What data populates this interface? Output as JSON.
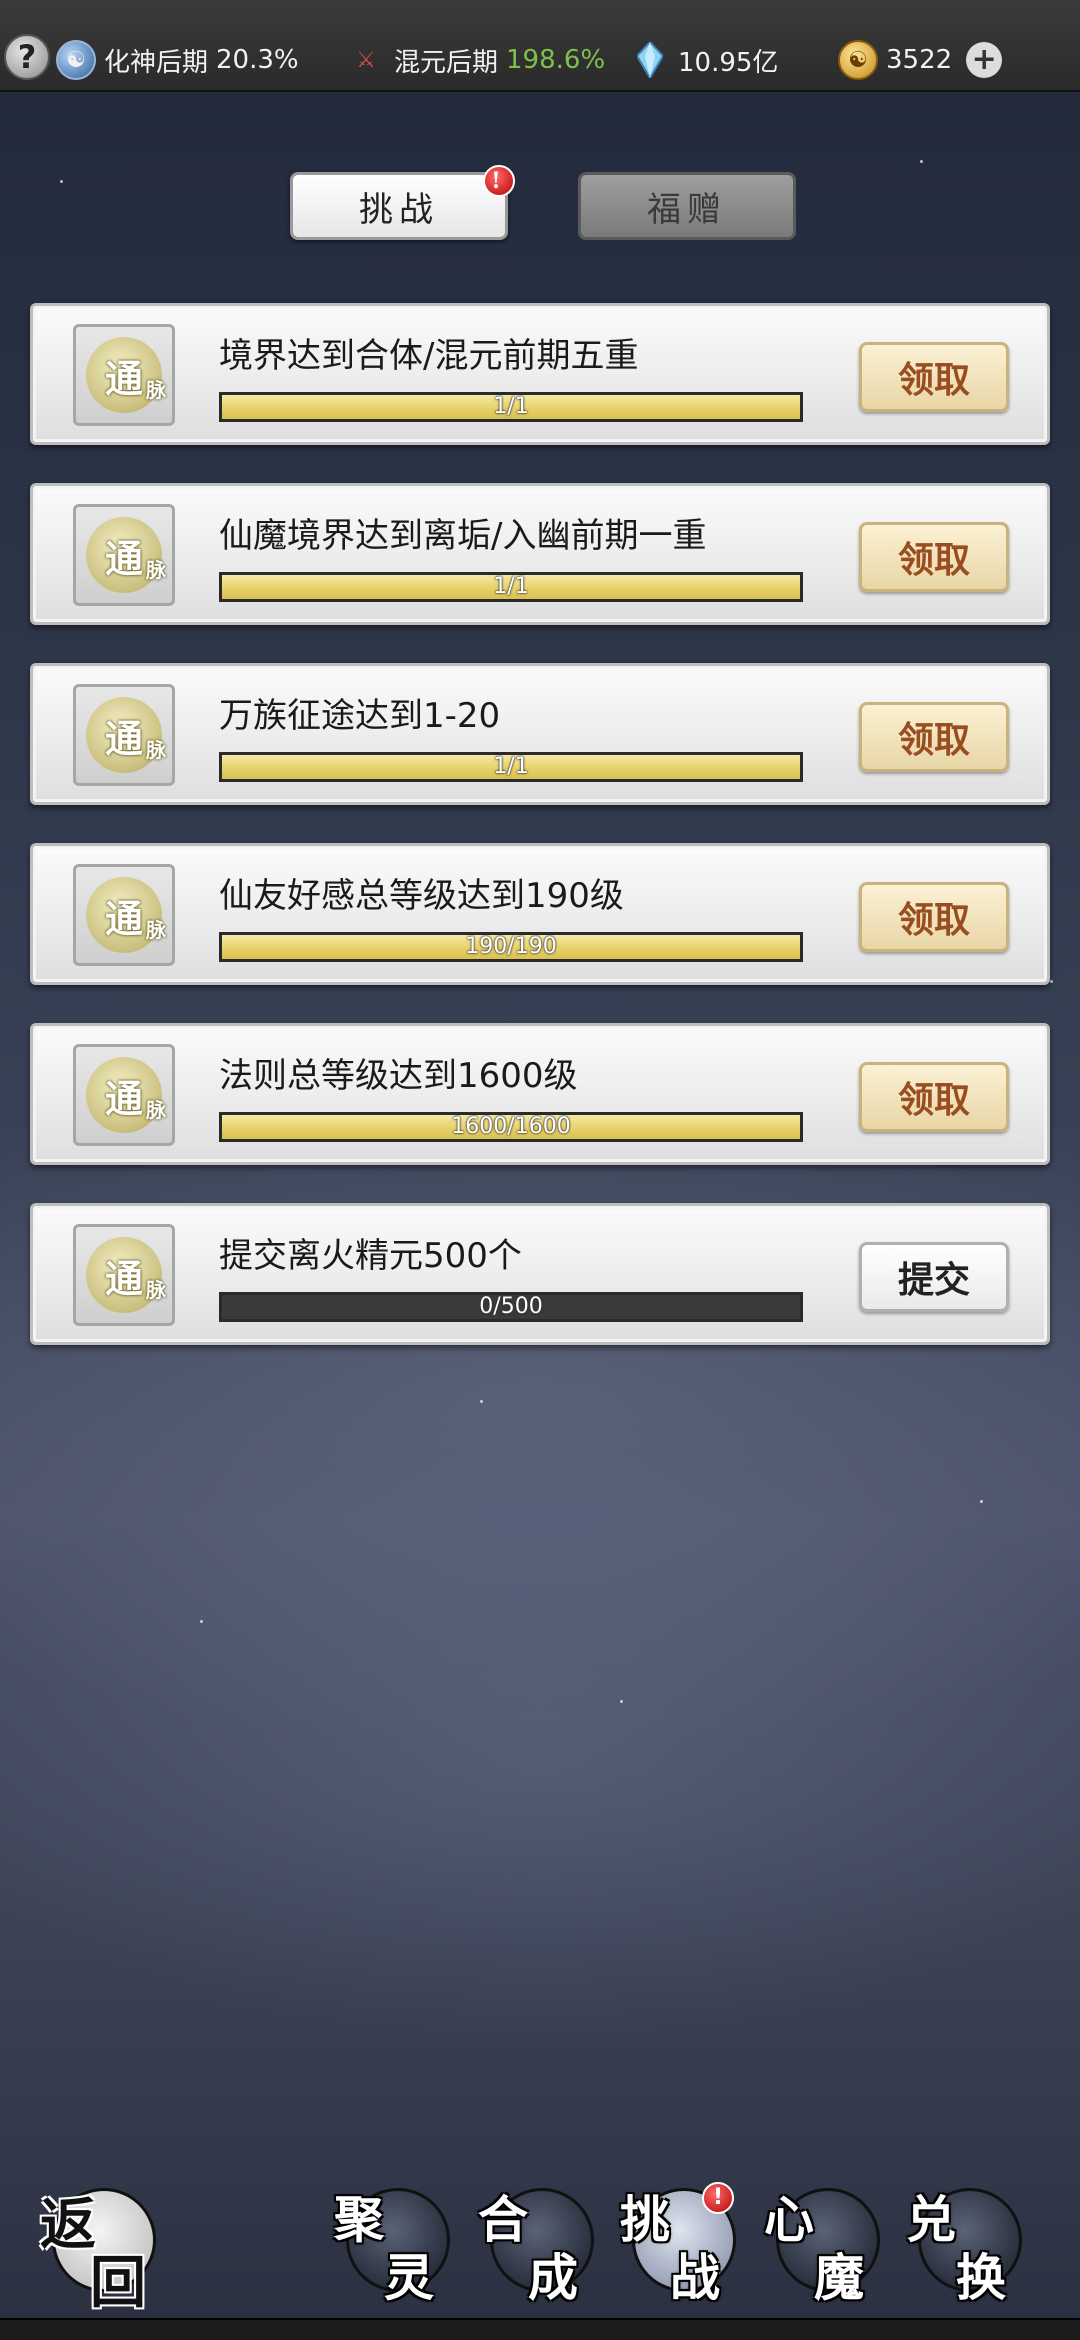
{
  "topbar": {
    "help_glyph": "?",
    "stats": [
      {
        "icon": "taiji-icon",
        "label": "化神后期",
        "value": "20.3%"
      },
      {
        "icon": "sword-icon",
        "label": "混元后期",
        "value": "198.6%"
      },
      {
        "icon": "crystal-icon",
        "value": "10.95亿"
      },
      {
        "icon": "coin-icon",
        "value": "3522"
      }
    ],
    "plus_glyph": "+"
  },
  "tabs": [
    {
      "label": "挑战",
      "active": true,
      "badge": "!"
    },
    {
      "label": "福赠",
      "active": false
    }
  ],
  "tasks": [
    {
      "title": "境界达到合体/混元前期五重",
      "progress_text": "1/1",
      "progress": 1.0,
      "button": "领取",
      "icon_main": "通",
      "icon_sub": "脉"
    },
    {
      "title": "仙魔境界达到离垢/入幽前期一重",
      "progress_text": "1/1",
      "progress": 1.0,
      "button": "领取",
      "icon_main": "通",
      "icon_sub": "脉"
    },
    {
      "title": "万族征途达到1-20",
      "progress_text": "1/1",
      "progress": 1.0,
      "button": "领取",
      "icon_main": "通",
      "icon_sub": "脉"
    },
    {
      "title": "仙友好感总等级达到190级",
      "progress_text": "190/190",
      "progress": 1.0,
      "button": "领取",
      "icon_main": "通",
      "icon_sub": "脉"
    },
    {
      "title": "法则总等级达到1600级",
      "progress_text": "1600/1600",
      "progress": 1.0,
      "button": "领取",
      "icon_main": "通",
      "icon_sub": "脉"
    },
    {
      "title": "提交离火精元500个",
      "progress_text": "0/500",
      "progress": 0.0,
      "button": "提交",
      "icon_main": "通",
      "icon_sub": "脉"
    }
  ],
  "bottom_nav": [
    {
      "c1": "返",
      "c2": "回"
    },
    {
      "c1": "聚",
      "c2": "灵"
    },
    {
      "c1": "合",
      "c2": "成"
    },
    {
      "c1": "挑",
      "c2": "战",
      "active": true,
      "badge": "!"
    },
    {
      "c1": "心",
      "c2": "魔"
    },
    {
      "c1": "兑",
      "c2": "换"
    }
  ],
  "colors": {
    "claim_text": "#9a4d20",
    "progress_fill": "#e8d36f",
    "green_value": "#7ec14a"
  }
}
